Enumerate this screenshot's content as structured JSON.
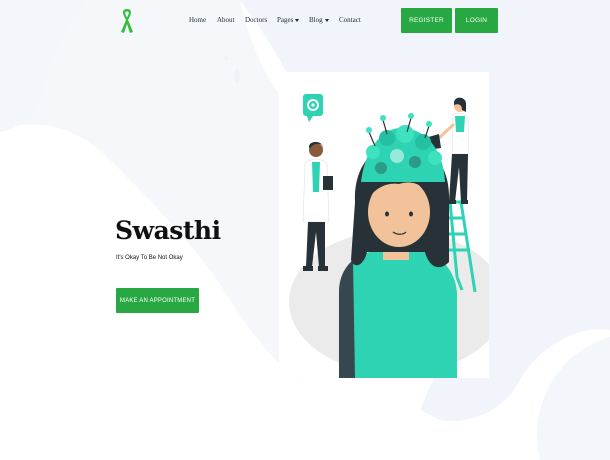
{
  "brand": {
    "logo_icon": "awareness-ribbon-icon",
    "accent_color": "#27a843"
  },
  "nav": {
    "items": [
      {
        "label": "Home",
        "has_dropdown": false
      },
      {
        "label": "About",
        "has_dropdown": false
      },
      {
        "label": "Doctors",
        "has_dropdown": false
      },
      {
        "label": "Pages",
        "has_dropdown": true
      },
      {
        "label": "Blog",
        "has_dropdown": true
      },
      {
        "label": "Contact",
        "has_dropdown": false
      }
    ]
  },
  "auth": {
    "register_label": "REGISTER",
    "login_label": "LOGIN"
  },
  "hero": {
    "title": "Swasthi",
    "tagline": "It's Okay To Be Not Okay",
    "cta_label": "MAKE AN APPOINTMENT"
  },
  "illustration": {
    "icon": "mental-health-illustration",
    "primary_color": "#2ed3b4"
  }
}
